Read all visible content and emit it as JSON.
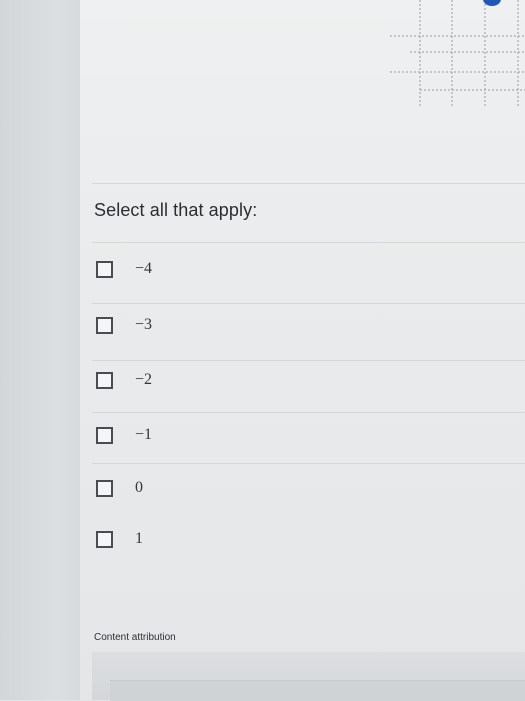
{
  "question": {
    "prompt": "Select all that apply:",
    "choices": [
      {
        "label": "−4",
        "checked": false
      },
      {
        "label": "−3",
        "checked": false
      },
      {
        "label": "−2",
        "checked": false
      },
      {
        "label": "−1",
        "checked": false
      },
      {
        "label": "0",
        "checked": false
      },
      {
        "label": "1",
        "checked": false
      }
    ]
  },
  "footer": {
    "attribution": "Content attribution"
  },
  "colors": {
    "accent_dot": "#1f58b6",
    "panel_bg": "#eceeef",
    "text": "#2b2d30"
  }
}
